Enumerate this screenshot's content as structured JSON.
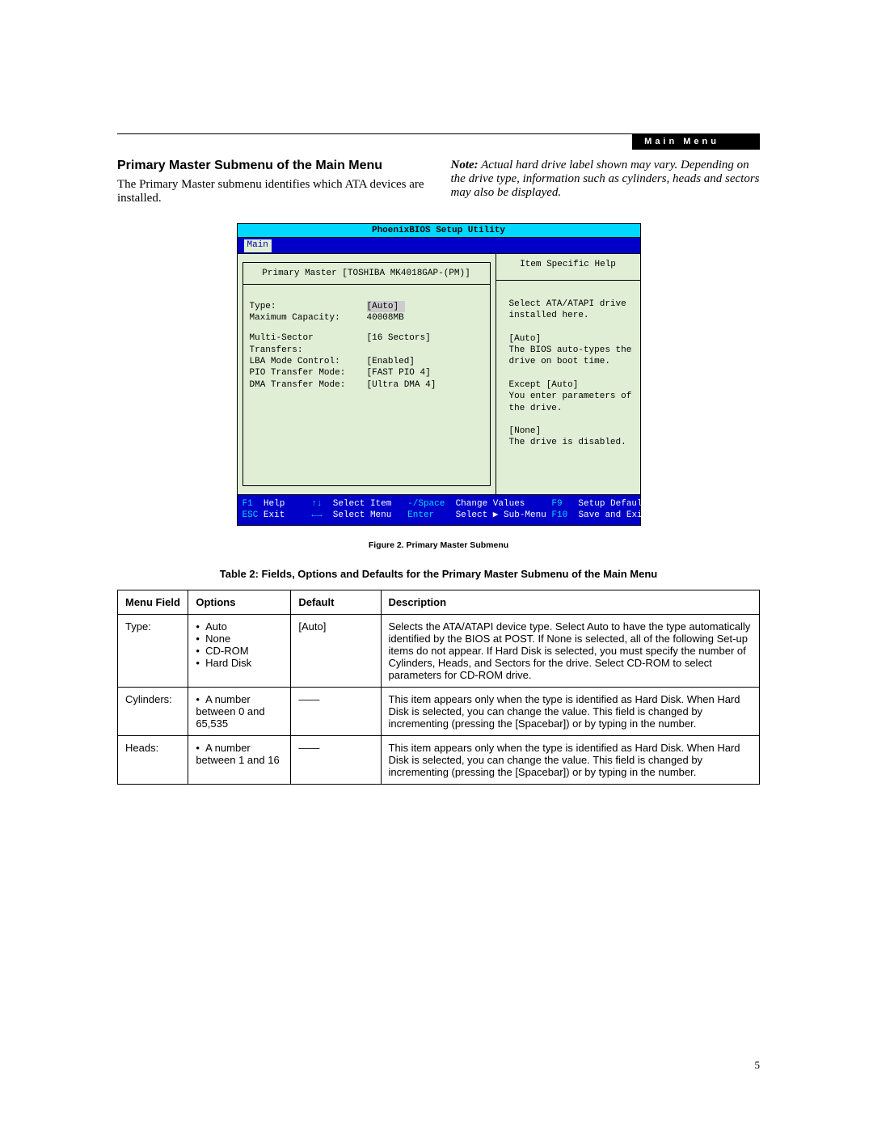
{
  "header": {
    "badge": "Main Menu"
  },
  "intro": {
    "title": "Primary Master Submenu of the Main Menu",
    "body": "The Primary Master submenu identifies which ATA devices are installed.",
    "note_label": "Note:",
    "note_body": " Actual hard drive label shown may vary. Depending on the drive type, information such as cylinders, heads and sectors may also be displayed."
  },
  "bios": {
    "title": "PhoenixBIOS Setup Utility",
    "tab": "Main",
    "left_head": "Primary Master [TOSHIBA MK4018GAP-(PM)]",
    "right_head": "Item Specific Help",
    "fields": [
      {
        "label": "Type:",
        "value": "[Auto]",
        "highlight": true
      },
      {
        "label": "Maximum Capacity:",
        "value": "40008MB"
      },
      {
        "gap": true
      },
      {
        "label": "Multi-Sector Transfers:",
        "value": "[16 Sectors]"
      },
      {
        "label": "LBA Mode Control:",
        "value": "[Enabled]"
      },
      {
        "label": "PIO Transfer Mode:",
        "value": "[FAST PIO 4]"
      },
      {
        "label": "DMA Transfer Mode:",
        "value": "[Ultra DMA 4]"
      }
    ],
    "help": [
      "Select ATA/ATAPI drive",
      "installed here.",
      "",
      "[Auto]",
      "The BIOS auto-types the",
      "drive on boot time.",
      "",
      "Except [Auto]",
      "You enter parameters of",
      "the drive.",
      "",
      "[None]",
      "The drive is disabled."
    ],
    "footer": {
      "row1": [
        {
          "k": "F1",
          "t": "Help"
        },
        {
          "k": "↑↓",
          "t": "Select Item"
        },
        {
          "k": "-/Space",
          "t": "Change Values"
        },
        {
          "k": "F9",
          "t": "Setup Defaults"
        }
      ],
      "row2": [
        {
          "k": "ESC",
          "t": "Exit"
        },
        {
          "k": "←→",
          "t": "Select Menu"
        },
        {
          "k": "Enter",
          "t": "Select ▶ Sub-Menu"
        },
        {
          "k": "F10",
          "t": "Save and Exit"
        }
      ]
    }
  },
  "figure_caption": "Figure 2.  Primary Master Submenu",
  "table_title": "Table 2: Fields, Options and Defaults for the Primary Master Submenu of the Main Menu",
  "table": {
    "headers": [
      "Menu Field",
      "Options",
      "Default",
      "Description"
    ],
    "rows": [
      {
        "field": "Type:",
        "options": [
          "Auto",
          "None",
          "CD-ROM",
          "Hard Disk"
        ],
        "default": "[Auto]",
        "desc": "Selects the ATA/ATAPI device type. Select Auto to have the type automatically identified by the BIOS at POST. If None is selected, all of the following Set-up items do not appear. If Hard Disk is selected, you must specify the number of Cylinders, Heads, and Sectors for the drive. Select CD-ROM to select parameters for CD-ROM drive."
      },
      {
        "field": "Cylinders:",
        "options": [
          "A number between 0 and 65,535"
        ],
        "default": "——",
        "desc": "This item appears only when the type is identified as Hard Disk. When Hard Disk is selected, you can change the value. This field is changed by incrementing (pressing the [Spacebar]) or by typing in the number."
      },
      {
        "field": "Heads:",
        "options": [
          "A number between 1 and 16"
        ],
        "default": "——",
        "desc": "This item appears only when the type is identified as Hard Disk. When Hard Disk is selected, you can change the value. This field is changed by incrementing (pressing the [Spacebar]) or by typing in the number."
      }
    ]
  },
  "page_number": "5"
}
